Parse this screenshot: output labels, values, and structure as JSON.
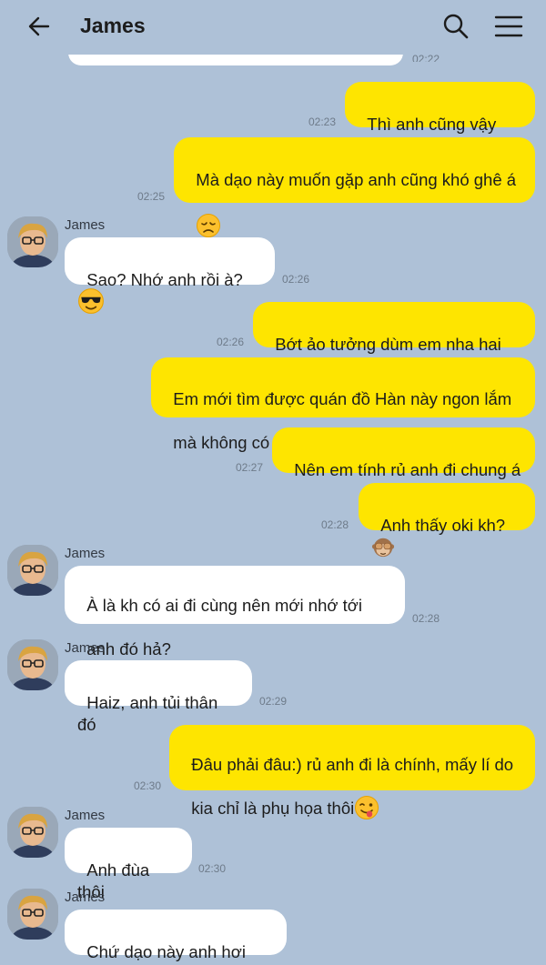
{
  "header": {
    "contact_name": "James"
  },
  "top_cut": {
    "time": "02:22"
  },
  "messages": [
    {
      "text": "Thì anh cũng vậy mà",
      "time": "02:23"
    },
    {
      "text": "Mà dạo này muốn gặp anh cũng khó ghê á",
      "time": "02:25"
    },
    {
      "sender": "James",
      "text": "Sao? Nhớ anh rồi à?",
      "time": "02:26"
    },
    {
      "text": "Bớt ảo tưởng dùm em nha hai",
      "time": "02:26"
    },
    {
      "line1": "Em mới tìm được quán đồ Hàn này ngon lắm",
      "line2": "mà không có ai đi cùng"
    },
    {
      "text": "Nên em tính rủ anh đi chung á",
      "time": "02:27"
    },
    {
      "text": "Anh thấy oki kh?",
      "time": "02:28"
    },
    {
      "sender": "James",
      "line1": "À là kh có ai đi cùng nên mới nhớ tới",
      "line2": "anh đó hả?",
      "time": "02:28"
    },
    {
      "sender": "James",
      "text": "Haiz, anh tủi thân đó",
      "time": "02:29"
    },
    {
      "line1": "Đâu phải đâu:) rủ anh đi là chính, mấy lí do",
      "line2": "kia chỉ là phụ họa thôi",
      "time": "02:30"
    },
    {
      "sender": "James",
      "text": "Anh đùa thôi",
      "time": "02:30"
    },
    {
      "sender": "James",
      "text": "Chứ dạo này anh hơi bận"
    }
  ],
  "icons": {
    "back": "arrow-left-icon",
    "search": "search-icon",
    "menu": "hamburger-menu-icon"
  },
  "colors": {
    "background": "#aec1d7",
    "my_bubble": "#fee500",
    "their_bubble": "#ffffff"
  }
}
